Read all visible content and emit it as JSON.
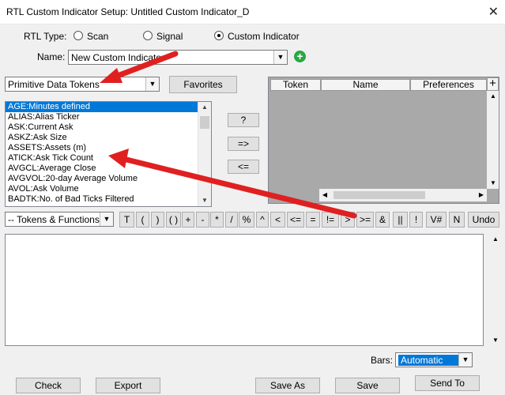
{
  "window": {
    "title": "RTL Custom Indicator Setup: Untitled Custom Indicator_D",
    "close_glyph": "✕"
  },
  "rtl_type": {
    "label": "RTL Type:",
    "options": [
      {
        "label": "Scan",
        "selected": false
      },
      {
        "label": "Signal",
        "selected": false
      },
      {
        "label": "Custom Indicator",
        "selected": true
      }
    ]
  },
  "name": {
    "label": "Name:",
    "value": "New Custom Indicator"
  },
  "data_tokens": {
    "selected": "Primitive Data Tokens",
    "favorites_label": "Favorites"
  },
  "token_list": [
    "AGE:Minutes defined",
    "ALIAS:Alias Ticker",
    "ASK:Current Ask",
    "ASKZ:Ask Size",
    "ASSETS:Assets (m)",
    "ATICK:Ask Tick Count",
    "AVGCL:Average Close",
    "AVGVOL:20-day Average Volume",
    "AVOL:Ask Volume",
    "BADTK:No. of Bad Ticks Filtered"
  ],
  "middle_buttons": {
    "help": "?",
    "add": "=>",
    "remove": "<="
  },
  "grid": {
    "columns": [
      "Token",
      "Name",
      "Preferences"
    ],
    "add_glyph": "+"
  },
  "tokens_functions": {
    "selected": "-- Tokens & Functions --"
  },
  "operators": [
    "T",
    "(",
    ")",
    "( )",
    "+",
    "-",
    "*",
    "/",
    "%",
    "^",
    "<",
    "<=",
    "=",
    "!=",
    ">",
    ">=",
    "&",
    "||",
    "!",
    "V#",
    "N",
    "Undo"
  ],
  "bars": {
    "label": "Bars:",
    "value": "Automatic"
  },
  "bottom_buttons": {
    "check": "Check",
    "export": "Export",
    "save_as": "Save As",
    "save": "Save",
    "send_to": "Send To"
  },
  "colors": {
    "arrow": "#e02020",
    "selection": "#0078d7",
    "grid_bg": "#a9a9a9",
    "add_icon": "#28a745"
  }
}
